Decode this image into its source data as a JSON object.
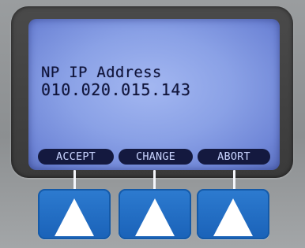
{
  "display": {
    "line1": "NP IP Address",
    "line2": "010.020.015.143"
  },
  "softkeys": [
    {
      "label": "ACCEPT"
    },
    {
      "label": "CHANGE"
    },
    {
      "label": "ABORT"
    }
  ],
  "buttons": [
    {
      "icon": "up-triangle-icon"
    },
    {
      "icon": "up-triangle-icon"
    },
    {
      "icon": "up-triangle-icon"
    }
  ],
  "colors": {
    "lcd_background": "#8aa1e6",
    "lcd_text": "#10143a",
    "softkey_background": "#14193f",
    "button_blue": "#2d7bd0",
    "panel_gray": "#9a9d9f"
  }
}
